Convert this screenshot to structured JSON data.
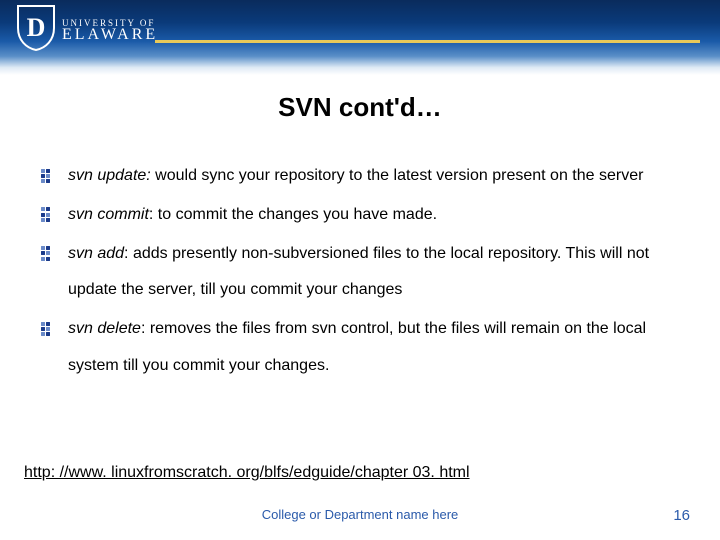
{
  "header": {
    "logo_line1": "UNIVERSITY OF",
    "logo_line2": "ELAWARE"
  },
  "title": "SVN cont'd…",
  "bullets": [
    {
      "cmd": "svn  update:",
      "body": " would sync your  repository to the latest version present on the server"
    },
    {
      "cmd": "svn commit",
      "body": ": to commit the changes you have made."
    },
    {
      "cmd": "svn add",
      "body": ": adds presently non-subversioned files to the local repository. This will not update the server, till you commit your changes"
    },
    {
      "cmd": "svn delete",
      "body": ": removes the files from svn control, but the files will remain on the local system till you commit your changes."
    }
  ],
  "link": "http: //www. linuxfromscratch. org/blfs/edguide/chapter 03. html",
  "footer": "College or Department name here",
  "page_number": "16"
}
